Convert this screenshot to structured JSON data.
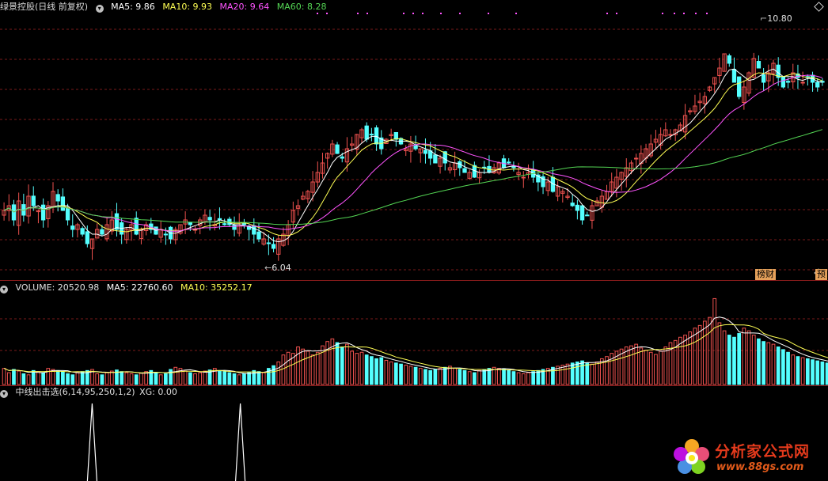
{
  "colors": {
    "up": "#f0524f",
    "down": "#54ffff",
    "ma5": "#ffffff",
    "ma10": "#ffff54",
    "ma20": "#ff54ff",
    "ma60": "#54d654",
    "grid": "#7a1a1a",
    "line": "#ffffff"
  },
  "header": {
    "title": "绿景控股(日线 前复权)",
    "ma5": "MA5: 9.86",
    "ma10": "MA10: 9.93",
    "ma20": "MA20: 9.64",
    "ma60": "MA60: 8.28"
  },
  "volume_header": {
    "title": "VOLUME: 20520.98",
    "ma5": "MA5: 22760.60",
    "ma10": "MA10: 35252.17"
  },
  "indicator_header": {
    "title": "中线出击选(6,14,95,250,1,2)",
    "xg": "XG: 0.00"
  },
  "annotations": {
    "high": "10.80",
    "low": "6.04"
  },
  "badges": {
    "rank": "榜财",
    "forecast": "预"
  },
  "watermark": {
    "title": "分析家公式网",
    "url": "www.88gs.com"
  },
  "chart_data": [
    {
      "type": "candlestick",
      "name": "price",
      "count": 170,
      "ylim": [
        5.8,
        11.3
      ],
      "grid": true,
      "close_approx": [
        7.2,
        7.3,
        7.0,
        7.4,
        7.1,
        7.5,
        7.3,
        7.2,
        7.0,
        7.3,
        7.6,
        7.4,
        7.2,
        7.0,
        6.8,
        6.9,
        6.7,
        6.5,
        6.6,
        6.8,
        6.7,
        6.9,
        7.0,
        6.8,
        6.7,
        6.8,
        6.9,
        6.7,
        6.8,
        6.9,
        6.8,
        6.7,
        6.8,
        6.7,
        6.6,
        6.8,
        6.9,
        7.0,
        6.9,
        6.8,
        7.0,
        7.1,
        7.0,
        6.9,
        7.0,
        6.9,
        6.9,
        6.8,
        6.9,
        6.9,
        6.8,
        6.7,
        6.6,
        6.6,
        6.5,
        6.4,
        6.6,
        6.7,
        6.9,
        7.2,
        7.3,
        7.5,
        7.6,
        7.8,
        8.0,
        8.2,
        8.4,
        8.6,
        8.4,
        8.3,
        8.5,
        8.6,
        8.8,
        8.9,
        8.7,
        8.8,
        8.6,
        8.5,
        8.7,
        8.8,
        8.7,
        8.6,
        8.5,
        8.6,
        8.5,
        8.5,
        8.4,
        8.3,
        8.2,
        8.3,
        8.2,
        8.1,
        8.2,
        8.1,
        8.0,
        8.0,
        7.9,
        8.0,
        8.1,
        8.0,
        8.1,
        8.2,
        8.1,
        8.2,
        8.1,
        8.0,
        7.9,
        8.0,
        7.9,
        7.8,
        7.7,
        7.8,
        7.6,
        7.7,
        7.6,
        7.5,
        7.3,
        7.2,
        7.0,
        7.1,
        7.3,
        7.4,
        7.5,
        7.6,
        7.8,
        7.9,
        8.0,
        8.1,
        8.2,
        8.3,
        8.4,
        8.5,
        8.6,
        8.7,
        8.8,
        8.9,
        8.8,
        8.9,
        9.0,
        9.2,
        9.3,
        9.4,
        9.5,
        9.6,
        9.8,
        10.0,
        10.2,
        10.5,
        10.3,
        9.9,
        9.6,
        9.8,
        10.1,
        10.4,
        10.2,
        9.9,
        10.1,
        10.3,
        10.0,
        9.8,
        9.9,
        10.1,
        10.0,
        9.9,
        10.0,
        9.9,
        9.8,
        9.9
      ]
    },
    {
      "type": "bar",
      "name": "volume",
      "count": 170,
      "ylim": [
        0,
        120000
      ],
      "values_approx": [
        30,
        22,
        28,
        25,
        20,
        18,
        26,
        24,
        22,
        30,
        28,
        26,
        24,
        20,
        18,
        22,
        24,
        26,
        28,
        20,
        18,
        22,
        25,
        27,
        24,
        22,
        20,
        18,
        21,
        24,
        26,
        22,
        18,
        20,
        28,
        32,
        30,
        25,
        22,
        20,
        22,
        25,
        27,
        30,
        26,
        24,
        22,
        20,
        18,
        20,
        22,
        26,
        24,
        22,
        30,
        35,
        42,
        55,
        60,
        58,
        70,
        66,
        62,
        55,
        60,
        72,
        80,
        85,
        78,
        70,
        75,
        62,
        58,
        60,
        55,
        52,
        48,
        50,
        45,
        42,
        40,
        38,
        36,
        34,
        32,
        30,
        28,
        26,
        28,
        30,
        32,
        34,
        30,
        28,
        26,
        24,
        22,
        26,
        28,
        30,
        32,
        30,
        28,
        26,
        24,
        22,
        20,
        22,
        24,
        26,
        28,
        30,
        32,
        34,
        36,
        38,
        40,
        42,
        44,
        40,
        38,
        42,
        48,
        52,
        58,
        62,
        66,
        70,
        72,
        75,
        68,
        64,
        60,
        56,
        62,
        70,
        78,
        82,
        88,
        92,
        98,
        105,
        110,
        118,
        125,
        160,
        115,
        100,
        92,
        88,
        95,
        105,
        100,
        92,
        85,
        80,
        78,
        75,
        70,
        65,
        60,
        55,
        52,
        50,
        48,
        46,
        44,
        42,
        40,
        38
      ]
    },
    {
      "type": "line",
      "name": "XG",
      "signals_at_fraction": [
        0.11,
        0.29
      ],
      "ylim": [
        0,
        1
      ]
    }
  ]
}
